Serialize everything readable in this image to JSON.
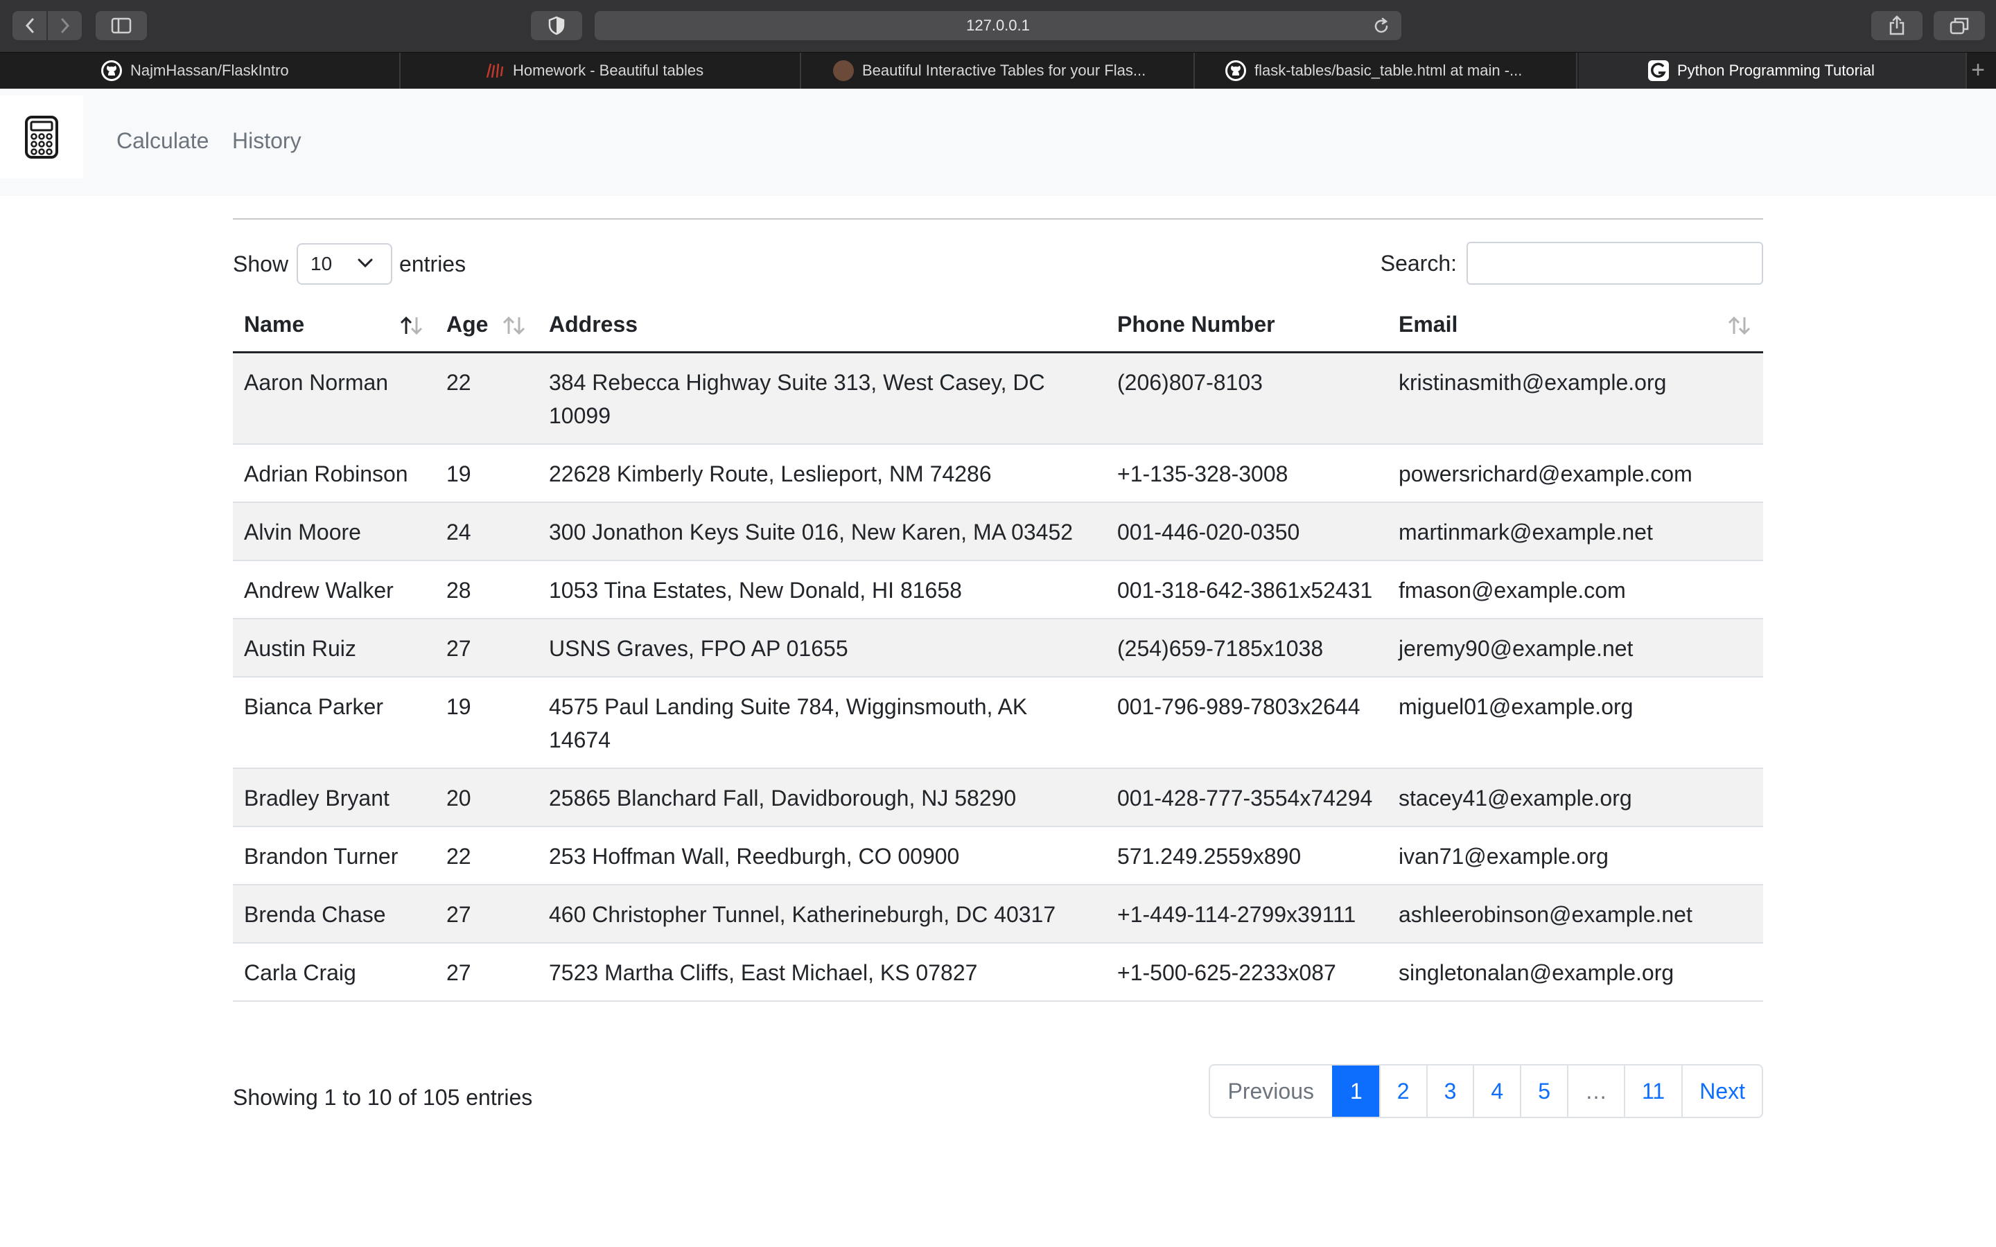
{
  "browser": {
    "url": "127.0.0.1",
    "tabs": [
      {
        "label": "NajmHassan/FlaskIntro",
        "icon": "github-icon"
      },
      {
        "label": "Homework - Beautiful tables",
        "icon": "site-icon"
      },
      {
        "label": "Beautiful Interactive Tables for your Flas...",
        "icon": "avatar-icon"
      },
      {
        "label": "flask-tables/basic_table.html at main -...",
        "icon": "github-icon"
      },
      {
        "label": "Python Programming Tutorial",
        "icon": "g-icon"
      }
    ]
  },
  "navbar": {
    "brand_icon": "calculator-icon",
    "links": [
      "Calculate",
      "History"
    ]
  },
  "table_controls": {
    "show_label": "Show",
    "entries_label": "entries",
    "page_length": "10",
    "search_label": "Search:",
    "search_value": ""
  },
  "table": {
    "columns": [
      "Name",
      "Age",
      "Address",
      "Phone Number",
      "Email"
    ],
    "rows": [
      [
        "Aaron Norman",
        "22",
        "384 Rebecca Highway Suite 313, West Casey, DC 10099",
        "(206)807-8103",
        "kristinasmith@example.org"
      ],
      [
        "Adrian Robinson",
        "19",
        "22628 Kimberly Route, Leslieport, NM 74286",
        "+1-135-328-3008",
        "powersrichard@example.com"
      ],
      [
        "Alvin Moore",
        "24",
        "300 Jonathon Keys Suite 016, New Karen, MA 03452",
        "001-446-020-0350",
        "martinmark@example.net"
      ],
      [
        "Andrew Walker",
        "28",
        "1053 Tina Estates, New Donald, HI 81658",
        "001-318-642-3861x52431",
        "fmason@example.com"
      ],
      [
        "Austin Ruiz",
        "27",
        "USNS Graves, FPO AP 01655",
        "(254)659-7185x1038",
        "jeremy90@example.net"
      ],
      [
        "Bianca Parker",
        "19",
        "4575 Paul Landing Suite 784, Wigginsmouth, AK 14674",
        "001-796-989-7803x2644",
        "miguel01@example.org"
      ],
      [
        "Bradley Bryant",
        "20",
        "25865 Blanchard Fall, Davidborough, NJ 58290",
        "001-428-777-3554x74294",
        "stacey41@example.org"
      ],
      [
        "Brandon Turner",
        "22",
        "253 Hoffman Wall, Reedburgh, CO 00900",
        "571.249.2559x890",
        "ivan71@example.org"
      ],
      [
        "Brenda Chase",
        "27",
        "460 Christopher Tunnel, Katherineburgh, DC 40317",
        "+1-449-114-2799x39111",
        "ashleerobinson@example.net"
      ],
      [
        "Carla Craig",
        "27",
        "7523 Martha Cliffs, East Michael, KS 07827",
        "+1-500-625-2233x087",
        "singletonalan@example.org"
      ]
    ]
  },
  "footer": {
    "info": "Showing 1 to 10 of 105 entries",
    "pagination": [
      "Previous",
      "1",
      "2",
      "3",
      "4",
      "5",
      "…",
      "11",
      "Next"
    ],
    "active_page": "1"
  },
  "colors": {
    "accent": "#0d6efd",
    "toolbar": "#333335",
    "tabbar": "#1e1e1f",
    "navbar": "#f8f9fa",
    "striped_row": "#f2f2f2"
  }
}
